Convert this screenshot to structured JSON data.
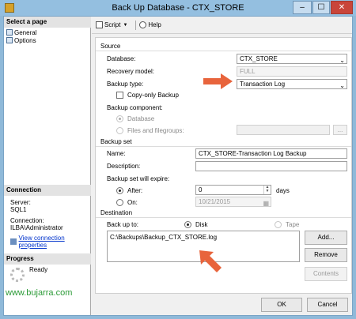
{
  "window": {
    "title": "Back Up Database - CTX_STORE",
    "minimize": "–",
    "maximize": "☐",
    "close": "✕"
  },
  "left_panel": {
    "select_page_label": "Select a page",
    "pages": [
      {
        "label": "General"
      },
      {
        "label": "Options"
      }
    ],
    "connection_label": "Connection",
    "server_label": "Server:",
    "server_value": "SQL1",
    "connection_user_label": "Connection:",
    "connection_user_value": "ILBA\\Administrator",
    "view_props_link": "View connection properties",
    "progress_label": "Progress",
    "progress_status": "Ready",
    "watermark": "www.bujarra.com"
  },
  "toolbar": {
    "script_label": "Script",
    "help_label": "Help"
  },
  "source": {
    "group_label": "Source",
    "database_label": "Database:",
    "database_value": "CTX_STORE",
    "recovery_label": "Recovery model:",
    "recovery_value": "FULL",
    "backup_type_label": "Backup type:",
    "backup_type_value": "Transaction Log",
    "copy_only_label": "Copy-only Backup",
    "component_label": "Backup component:",
    "component_database": "Database",
    "component_files": "Files and filegroups:",
    "browse_label": "..."
  },
  "backup_set": {
    "group_label": "Backup set",
    "name_label": "Name:",
    "name_value": "CTX_STORE-Transaction Log  Backup",
    "description_label": "Description:",
    "description_value": "",
    "expire_label": "Backup set will expire:",
    "after_label": "After:",
    "after_value": "0",
    "days_label": "days",
    "on_label": "On:",
    "on_value": "10/21/2015"
  },
  "destination": {
    "group_label": "Destination",
    "back_up_to_label": "Back up to:",
    "disk_label": "Disk",
    "tape_label": "Tape",
    "paths": [
      "C:\\Backups\\Backup_CTX_STORE.log"
    ],
    "add_label": "Add...",
    "remove_label": "Remove",
    "contents_label": "Contents"
  },
  "footer": {
    "ok_label": "OK",
    "cancel_label": "Cancel"
  },
  "colors": {
    "title_bar": "#94bfe0",
    "close_button": "#c9453a",
    "annotation_arrow": "#e8643c",
    "link": "#0033cc"
  }
}
